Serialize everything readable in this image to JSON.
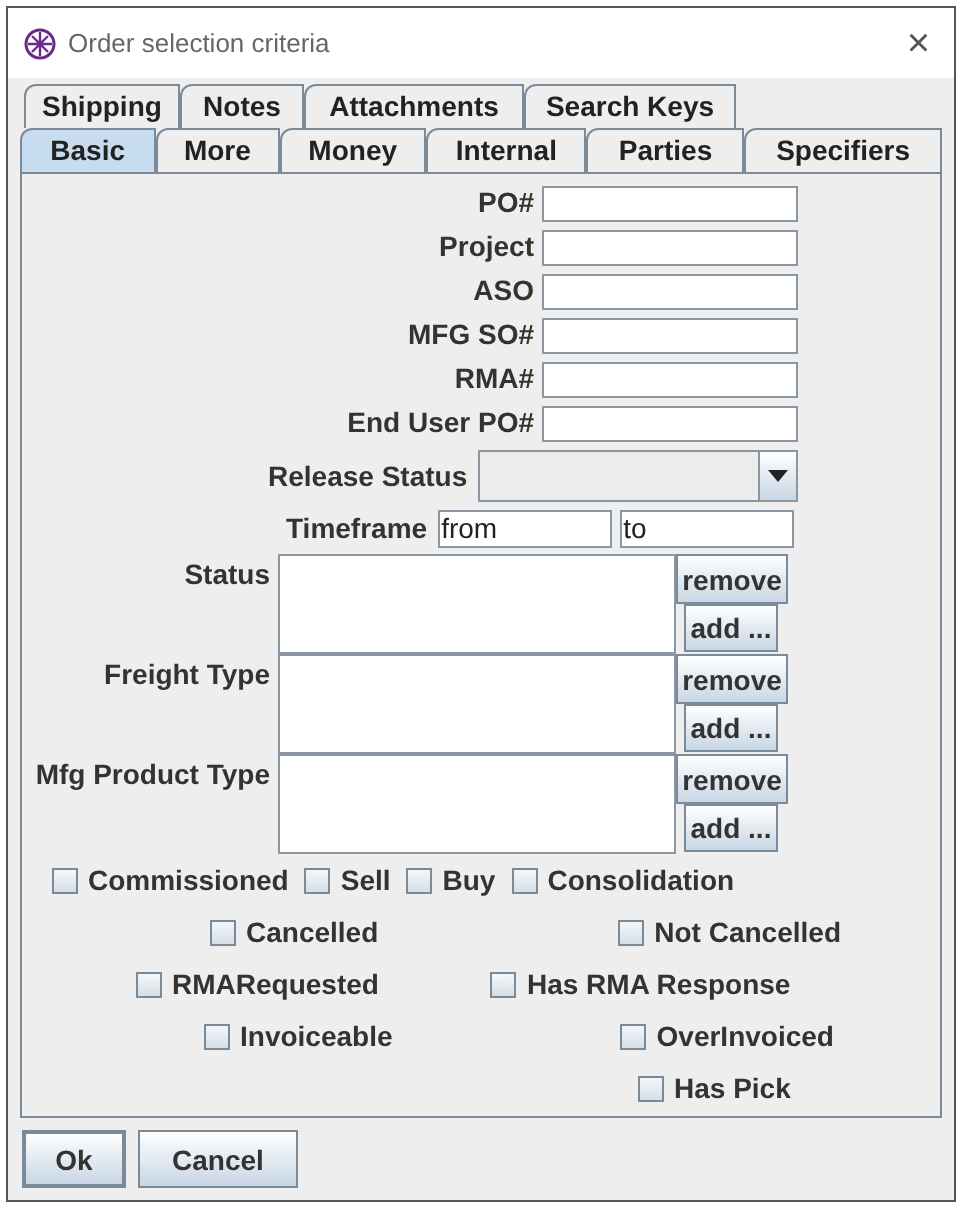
{
  "window": {
    "title": "Order selection criteria",
    "close": "×"
  },
  "tab_rows": [
    [
      {
        "label": "Shipping",
        "selected": false
      },
      {
        "label": "Notes",
        "selected": false
      },
      {
        "label": "Attachments",
        "selected": false
      },
      {
        "label": "Search Keys",
        "selected": false
      }
    ],
    [
      {
        "label": "Basic",
        "selected": true
      },
      {
        "label": "More",
        "selected": false
      },
      {
        "label": "Money",
        "selected": false
      },
      {
        "label": "Internal",
        "selected": false
      },
      {
        "label": "Parties",
        "selected": false
      },
      {
        "label": "Specifiers",
        "selected": false
      }
    ]
  ],
  "text_fields": [
    {
      "label": "PO#"
    },
    {
      "label": "Project"
    },
    {
      "label": "ASO"
    },
    {
      "label": "MFG SO#"
    },
    {
      "label": "RMA#"
    },
    {
      "label": "End User PO#"
    }
  ],
  "release_status": {
    "label": "Release Status"
  },
  "timeframe": {
    "label": "Timeframe",
    "from": "from",
    "to": "to"
  },
  "lists": [
    {
      "label": "Status",
      "remove": "remove",
      "add": "add ..."
    },
    {
      "label": "Freight Type",
      "remove": "remove",
      "add": "add ..."
    },
    {
      "label": "Mfg Product Type",
      "remove": "remove",
      "add": "add ..."
    }
  ],
  "checkbox_rows": [
    [
      {
        "label": "Commissioned",
        "checked": false
      },
      {
        "label": "Sell",
        "checked": false
      },
      {
        "label": "Buy",
        "checked": false
      },
      {
        "label": "Consolidation",
        "checked": false
      }
    ],
    [
      {
        "label": "Cancelled",
        "checked": false
      },
      {
        "label": "Not Cancelled",
        "checked": false
      }
    ],
    [
      {
        "label": "RMARequested",
        "checked": false
      },
      {
        "label": "Has RMA Response",
        "checked": false
      }
    ],
    [
      {
        "label": "Invoiceable",
        "checked": false
      },
      {
        "label": "OverInvoiced",
        "checked": false
      }
    ],
    [
      {
        "label": "Has Pick",
        "checked": false
      }
    ]
  ],
  "buttons": [
    {
      "label": "Ok",
      "selected": true
    },
    {
      "label": "Cancel",
      "selected": false
    }
  ]
}
